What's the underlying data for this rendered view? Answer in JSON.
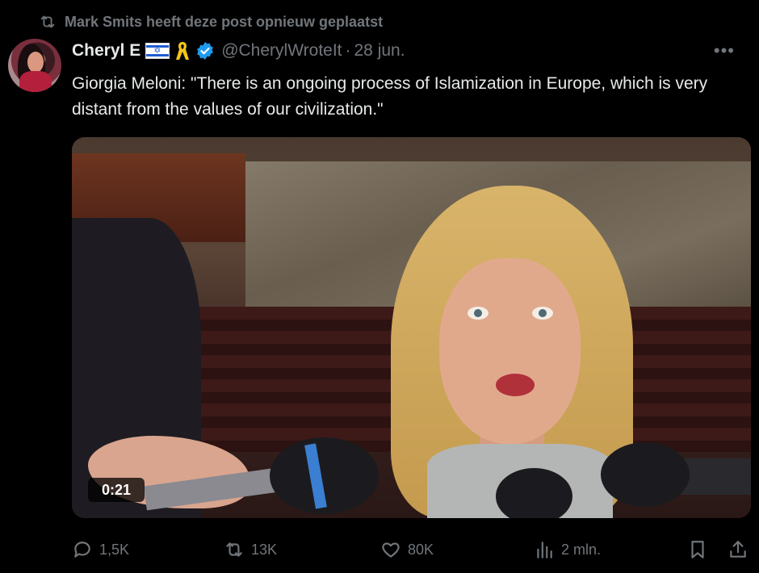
{
  "repost": {
    "text": "Mark Smits heeft deze post opnieuw geplaatst",
    "icon": "repost-icon"
  },
  "author": {
    "name": "Cheryl E",
    "handle": "@CherylWroteIt",
    "separator": "·",
    "date": "28 jun.",
    "badges": [
      "israel-flag-icon",
      "yellow-ribbon-icon",
      "verified-icon"
    ]
  },
  "menu": {
    "more_label": "•••"
  },
  "tweet": {
    "text": "Giorgia Meloni: \"There is an ongoing process of Islamization in Europe, which is very distant from the values of our civilization.\""
  },
  "media": {
    "type": "video",
    "duration": "0:21"
  },
  "actions": {
    "replies": "1,5K",
    "reposts": "13K",
    "likes": "80K",
    "views": "2 mln."
  },
  "colors": {
    "background": "#000000",
    "text": "#e7e9ea",
    "muted": "#71767b",
    "verified": "#1d9bf0",
    "ribbon": "#f5c518"
  }
}
